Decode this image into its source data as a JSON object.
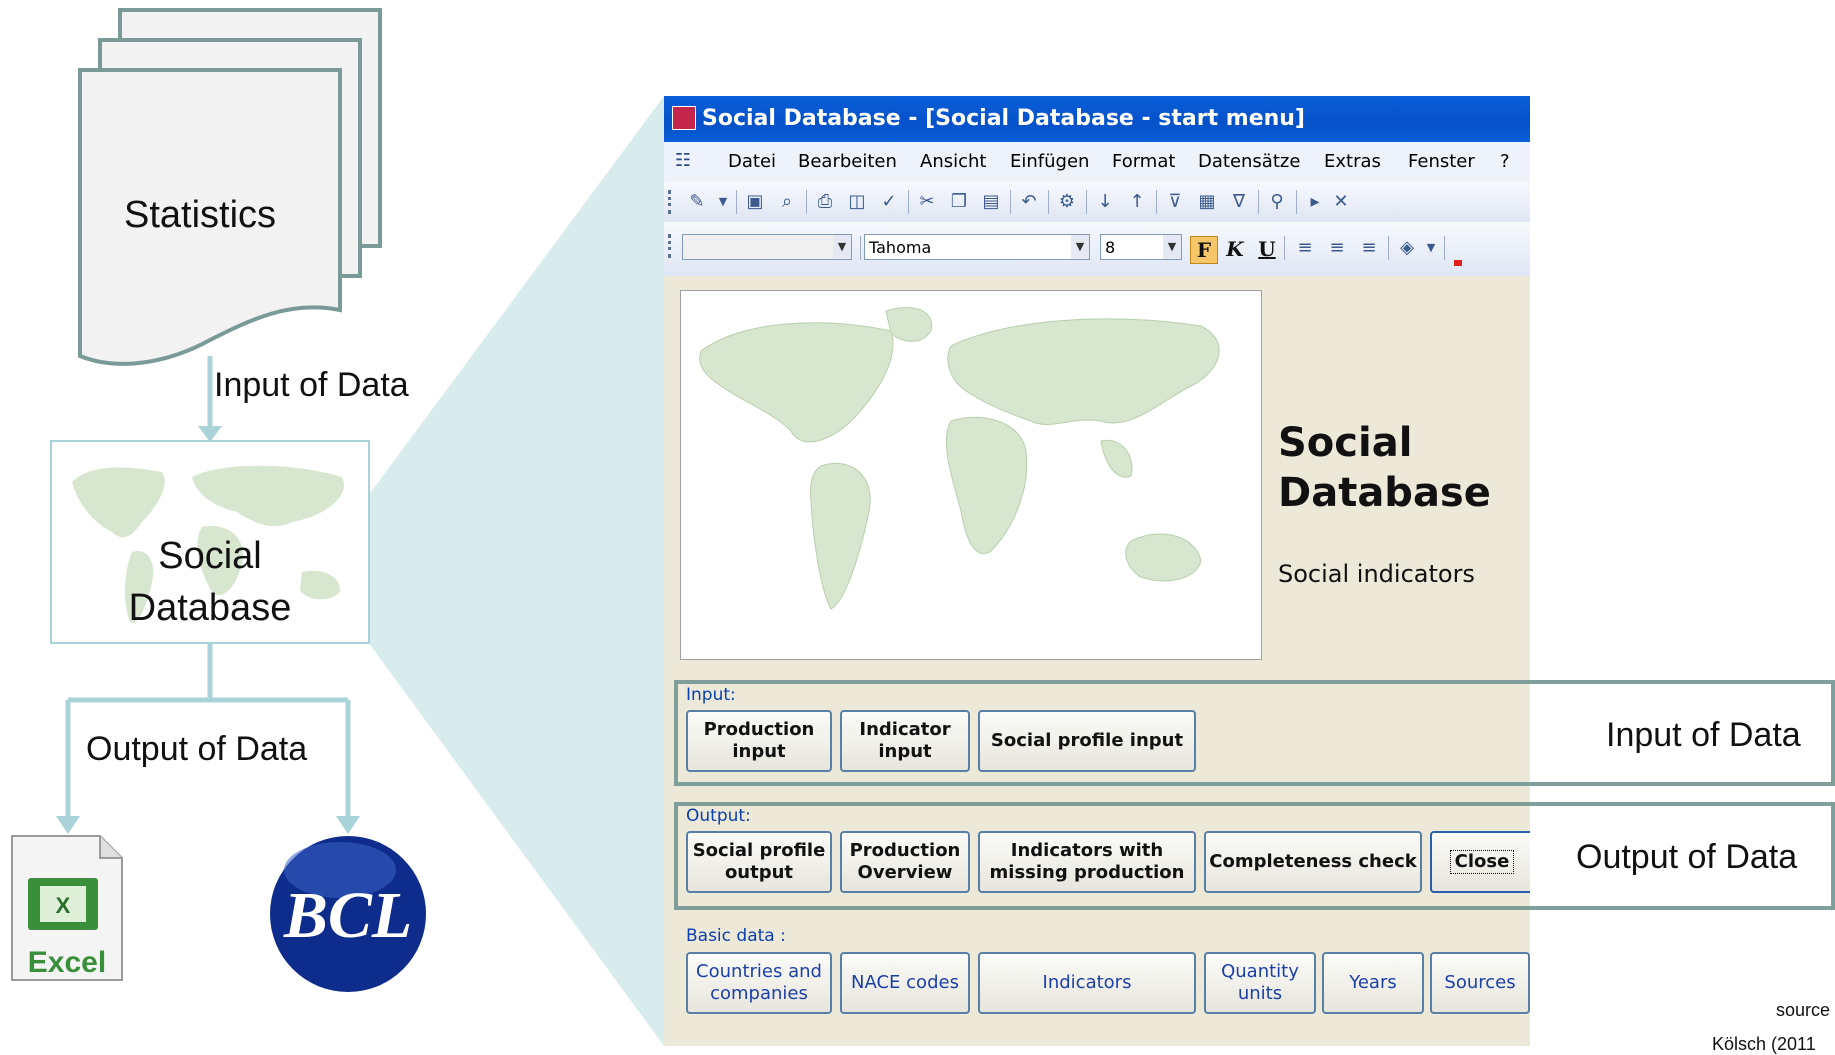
{
  "diagram": {
    "statistics_label": "Statistics",
    "input_label": "Input of Data",
    "database_label_line1": "Social",
    "database_label_line2": "Database",
    "output_label": "Output of Data",
    "excel_label": "Excel",
    "bcl_label": "BCL"
  },
  "window": {
    "title": "Social Database - [Social Database - start menu]",
    "menu": [
      "Datei",
      "Bearbeiten",
      "Ansicht",
      "Einfügen",
      "Format",
      "Datensätze",
      "Extras",
      "Fenster",
      "?"
    ],
    "font_name": "Tahoma",
    "font_size": "8",
    "format_buttons": [
      "F",
      "K",
      "U"
    ]
  },
  "form": {
    "title_line1": "Social",
    "title_line2": "Database",
    "subtitle": "Social indicators",
    "input_section": {
      "label": "Input:",
      "buttons": [
        {
          "line1": "Production",
          "line2": "input"
        },
        {
          "line1": "Indicator",
          "line2": "input"
        },
        {
          "line1": "Social profile input",
          "line2": ""
        }
      ]
    },
    "output_section": {
      "label": "Output:",
      "buttons": [
        {
          "line1": "Social profile",
          "line2": "output"
        },
        {
          "line1": "Production",
          "line2": "Overview"
        },
        {
          "line1": "Indicators with",
          "line2": "missing production"
        },
        {
          "line1": "Completeness check",
          "line2": ""
        },
        {
          "line1": "Close",
          "line2": ""
        }
      ]
    },
    "basic_section": {
      "label": "Basic data :",
      "buttons": [
        {
          "line1": "Countries and",
          "line2": "companies"
        },
        {
          "line1": "NACE codes",
          "line2": ""
        },
        {
          "line1": "Indicators",
          "line2": ""
        },
        {
          "line1": "Quantity",
          "line2": "units"
        },
        {
          "line1": "Years",
          "line2": ""
        },
        {
          "line1": "Sources",
          "line2": ""
        }
      ]
    }
  },
  "annotations": {
    "input_label": "Input of Data",
    "output_label": "Output of Data",
    "source_line1": "source",
    "source_line2": "Kölsch (2011"
  },
  "colors": {
    "connector": "#a9d3d8",
    "titlebar": "#0551c9",
    "form_bg": "#ece9d8",
    "section_text": "#0b3fae",
    "map_land": "#d7e6cf"
  }
}
